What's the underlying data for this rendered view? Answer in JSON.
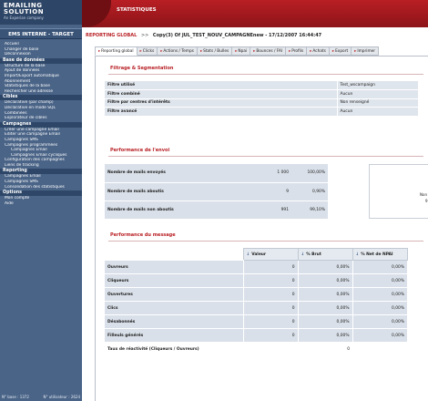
{
  "brand": {
    "line1": "EMAILING",
    "line2": "SOLUTION",
    "tagline": "An Experian company"
  },
  "environment": "EMS INTERNE - TARGET",
  "sidebar": {
    "groups": [
      {
        "section": "",
        "items": [
          {
            "label": "Accueil",
            "sub": false
          },
          {
            "label": "Changer de base",
            "sub": false
          },
          {
            "label": "Déconnexion",
            "sub": false
          }
        ]
      },
      {
        "section": "Base de données",
        "items": [
          {
            "label": "Structure de la base",
            "sub": false
          },
          {
            "label": "Ajout de données",
            "sub": false
          },
          {
            "label": "Import/Export automatique",
            "sub": false
          },
          {
            "label": "Abonnement",
            "sub": false
          },
          {
            "label": "Statistiques de la base",
            "sub": false
          },
          {
            "label": "Rechercher une adresse",
            "sub": false
          }
        ]
      },
      {
        "section": "Cibles",
        "items": [
          {
            "label": "Déclarative (par champ)",
            "sub": false
          },
          {
            "label": "Déclarative en mode SQL",
            "sub": false
          },
          {
            "label": "Combinées",
            "sub": false
          },
          {
            "label": "Explorateur de cibles",
            "sub": false
          }
        ]
      },
      {
        "section": "Campagnes",
        "items": [
          {
            "label": "Créer une campagne Email",
            "sub": false
          },
          {
            "label": "Editer une campagne Email",
            "sub": false
          },
          {
            "label": "Campagnes SMS",
            "sub": false
          },
          {
            "label": "Campagnes programmées",
            "sub": false
          },
          {
            "label": "Campagnes Email",
            "sub": true
          },
          {
            "label": "Campagnes Email cycliques",
            "sub": true
          },
          {
            "label": "Configuration des campagnes",
            "sub": false
          },
          {
            "label": "Liens de tracking",
            "sub": false
          }
        ]
      },
      {
        "section": "Reporting",
        "items": [
          {
            "label": "Campagnes Email",
            "sub": false
          },
          {
            "label": "Campagnes SMS",
            "sub": false
          },
          {
            "label": "Consolidation des statistiques",
            "sub": false
          }
        ]
      },
      {
        "section": "Options",
        "items": [
          {
            "label": "Mon compte",
            "sub": false
          },
          {
            "label": "Aide",
            "sub": false
          }
        ]
      }
    ],
    "footer": {
      "base": "N° base : 1372",
      "user": "N° utilisateur : 2624"
    }
  },
  "header": {
    "title": "STATISTIQUES"
  },
  "breadcrumb": {
    "root": "REPORTING GLOBAL",
    "separator": ">>",
    "path": "Copy(3) Of JUL_TEST_NOUV_CAMPAGNEnew - 17/12/2007 16:44:47"
  },
  "tabs": [
    {
      "label": "Reporting global",
      "active": true
    },
    {
      "label": "Clicks",
      "active": false
    },
    {
      "label": "Actions / Temps",
      "active": false
    },
    {
      "label": "Stats / Bulles",
      "active": false
    },
    {
      "label": "Npai",
      "active": false
    },
    {
      "label": "Bounces / FAI",
      "active": false
    },
    {
      "label": "Profils",
      "active": false
    },
    {
      "label": "Achats",
      "active": false
    },
    {
      "label": "Export",
      "active": false
    },
    {
      "label": "Imprimer",
      "active": false
    }
  ],
  "filters": {
    "title": "Filtrage & Segmentation",
    "rows": [
      {
        "label": "Filtre utilisé",
        "value": "Test_wscampaign"
      },
      {
        "label": "Filtre combiné",
        "value": "Aucun"
      },
      {
        "label": "Filtre par centres d'intérêts",
        "value": "Non renseigné"
      },
      {
        "label": "Filtre avancé",
        "value": "Aucun"
      }
    ]
  },
  "envoi": {
    "title": "Performance de l'envoi",
    "rows": [
      {
        "label": "Nombre de mails envoyés",
        "count": "1 000",
        "percent": "100,00%"
      },
      {
        "label": "Nombre de mails aboutis",
        "count": "9",
        "percent": "0,90%"
      },
      {
        "label": "Nombre de mails non aboutis",
        "count": "991",
        "percent": "99,10%"
      }
    ],
    "pie_label_1": "Non",
    "pie_label_2": "9"
  },
  "message": {
    "title": "Performance du message",
    "headers": [
      "Valeur",
      "% Brut",
      "% Net de NPAI"
    ],
    "rows": [
      {
        "label": "Ouvreurs",
        "value": "0",
        "brut": "0,00%",
        "net": "0,00%"
      },
      {
        "label": "Cliqueurs",
        "value": "0",
        "brut": "0,00%",
        "net": "0,00%"
      },
      {
        "label": "Ouvertures",
        "value": "0",
        "brut": "0,00%",
        "net": "0,00%"
      },
      {
        "label": "Clics",
        "value": "0",
        "brut": "0,00%",
        "net": "0,00%"
      },
      {
        "label": "Désabonnés",
        "value": "0",
        "brut": "0,00%",
        "net": "0,00%"
      },
      {
        "label": "Filleuls générés",
        "value": "0",
        "brut": "0,00%",
        "net": "0,00%"
      }
    ],
    "total_label": "Taux de réactivité (Cliqueurs / Ouvreurs)",
    "total_value": "0"
  },
  "colors": {
    "brand_red": "#b81f24",
    "sidebar_blue": "#4a6487",
    "row_blue": "#d9e0e9"
  }
}
